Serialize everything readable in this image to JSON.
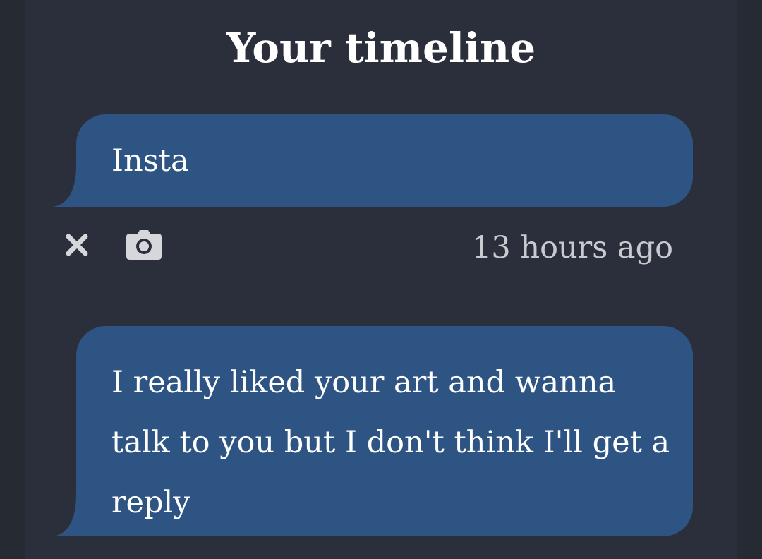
{
  "header": {
    "title": "Your timeline"
  },
  "messages": [
    {
      "text": "Insta"
    },
    {
      "text": "I really liked your art and wanna talk to you but I don't think I'll get a reply"
    }
  ],
  "message_meta": {
    "timestamp": "13 hours ago",
    "icons": [
      "close-icon",
      "camera-icon"
    ]
  },
  "colors": {
    "background": "#262a33",
    "panel": "#2b2f3b",
    "bubble": "#2e5483",
    "text": "#ffffff",
    "muted": "#c8cad0"
  }
}
